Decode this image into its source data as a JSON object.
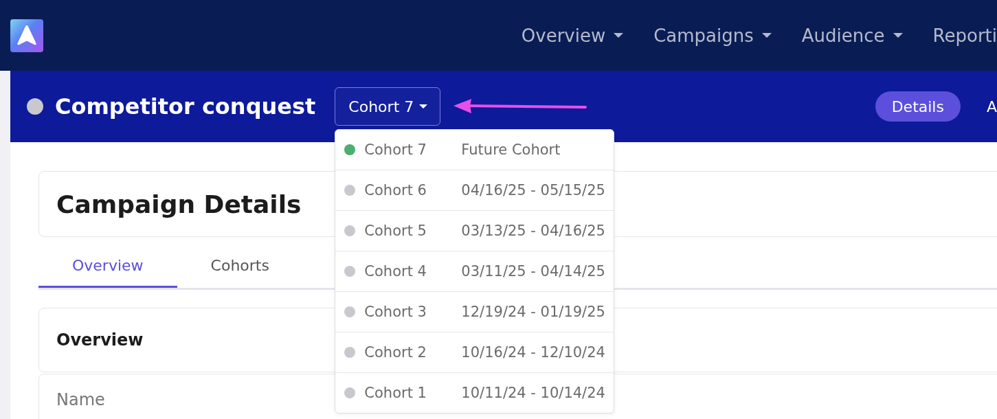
{
  "top_nav": {
    "items": [
      {
        "label": "Overview",
        "dropdown": true
      },
      {
        "label": "Campaigns",
        "dropdown": true
      },
      {
        "label": "Audience",
        "dropdown": true
      },
      {
        "label": "Reporti",
        "dropdown": false
      }
    ]
  },
  "campaign_header": {
    "title": "Competitor conquest",
    "cohort_button": {
      "label": "Cohort 7",
      "expanded": true
    },
    "tabs": [
      {
        "label": "Details",
        "selected": true
      },
      {
        "label": "A",
        "selected": false
      }
    ]
  },
  "cohort_menu": {
    "items": [
      {
        "name": "Cohort 7",
        "dates": "Future Cohort",
        "color": "#4caf6e"
      },
      {
        "name": "Cohort 6",
        "dates": "04/16/25 - 05/15/25",
        "color": "#c9c8ce"
      },
      {
        "name": "Cohort 5",
        "dates": "03/13/25 - 04/16/25",
        "color": "#c9c8ce"
      },
      {
        "name": "Cohort 4",
        "dates": "03/11/25 - 04/14/25",
        "color": "#c9c8ce"
      },
      {
        "name": "Cohort 3",
        "dates": "12/19/24 - 01/19/25",
        "color": "#c9c8ce"
      },
      {
        "name": "Cohort 2",
        "dates": "10/16/24 - 12/10/24",
        "color": "#c9c8ce"
      },
      {
        "name": "Cohort 1",
        "dates": "10/11/24 - 10/14/24",
        "color": "#c9c8ce"
      }
    ]
  },
  "page": {
    "title": "Campaign Details",
    "tabs": [
      {
        "label": "Overview",
        "selected": true
      },
      {
        "label": "Cohorts",
        "selected": false
      }
    ],
    "section": {
      "title": "Overview",
      "fields": [
        {
          "label": "Name"
        }
      ]
    }
  }
}
